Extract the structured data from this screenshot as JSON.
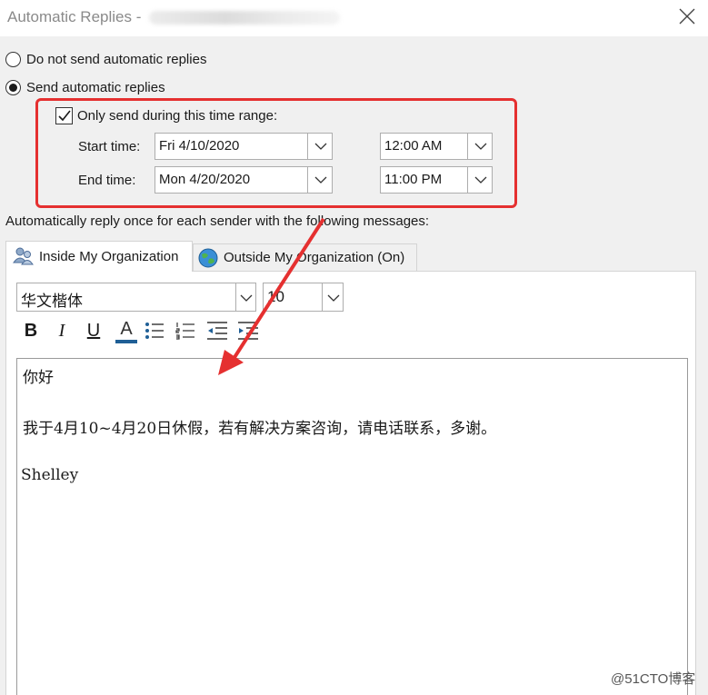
{
  "window": {
    "title": "Automatic Replies -",
    "close_icon": "close-icon"
  },
  "options": {
    "do_not_send_label": "Do not send automatic replies",
    "send_label": "Send automatic replies",
    "send_selected": true
  },
  "time_range": {
    "checkbox_label": "Only send during this time range:",
    "checked": true,
    "start_label": "Start time:",
    "start_date": "Fri 4/10/2020",
    "start_time": "12:00 AM",
    "end_label": "End time:",
    "end_date": "Mon 4/20/2020",
    "end_time": "11:00 PM"
  },
  "reply_instructions": "Automatically reply once for each sender with the following messages:",
  "tabs": [
    {
      "label": "Inside My Organization",
      "icon": "people-icon",
      "active": true
    },
    {
      "label": "Outside My Organization (On)",
      "icon": "globe-icon",
      "active": false
    }
  ],
  "formatting": {
    "font_name": "华文楷体",
    "font_size": "10",
    "bold": "B",
    "italic": "I",
    "underline": "U",
    "font_color": "A"
  },
  "message": {
    "line1": "你好",
    "line2": "我于4月10~4月20日休假，若有解决方案咨询，请电话联系，多谢。",
    "line3": "Shelley"
  },
  "annotation": {
    "box_color": "#e53030",
    "arrow_color": "#e53030"
  },
  "watermark": "@51CTO博客"
}
